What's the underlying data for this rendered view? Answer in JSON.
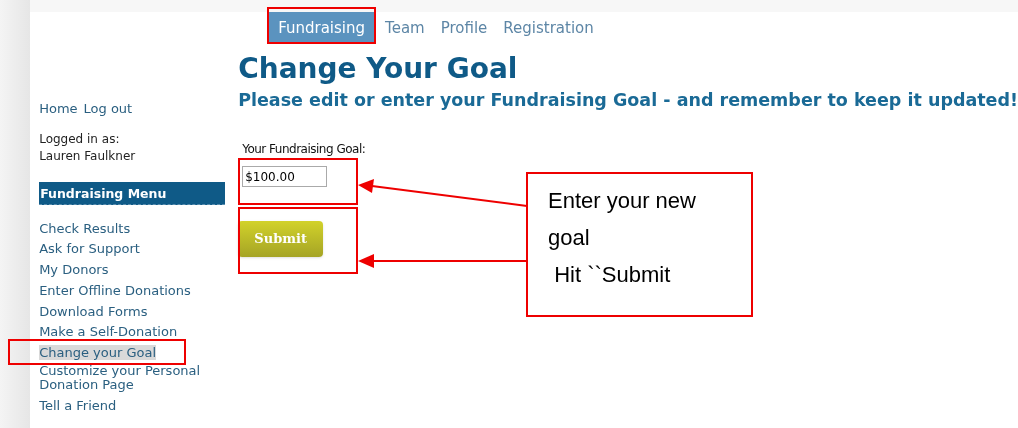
{
  "tabs": [
    {
      "label": "Fundraising",
      "selected": true
    },
    {
      "label": "Team",
      "selected": false
    },
    {
      "label": "Profile",
      "selected": false
    },
    {
      "label": "Registration",
      "selected": false
    }
  ],
  "sidebar": {
    "links": [
      "Home",
      "Log out"
    ],
    "logged_in_label": "Logged in as:",
    "user_name": "Lauren Faulkner",
    "menu_title": "Fundraising Menu",
    "items": [
      {
        "label": "Check Results",
        "selected": false
      },
      {
        "label": "Ask for Support",
        "selected": false
      },
      {
        "label": "My Donors",
        "selected": false
      },
      {
        "label": "Enter Offline Donations",
        "selected": false
      },
      {
        "label": "Download Forms",
        "selected": false
      },
      {
        "label": "Make a Self-Donation",
        "selected": false
      },
      {
        "label": "Change your Goal",
        "selected": true
      },
      {
        "label": "Customize your Personal Donation Page",
        "selected": false
      },
      {
        "label": "Tell a Friend",
        "selected": false
      }
    ]
  },
  "main": {
    "title": "Change Your Goal",
    "subtitle": "Please edit or enter your Fundraising Goal - and remember to keep it updated!",
    "field_label": "Your Fundraising Goal:",
    "field_value": "$100.00",
    "submit": "Submit"
  },
  "callout": {
    "lines": [
      "Enter your new goal",
      " Hit ``Submit"
    ]
  }
}
